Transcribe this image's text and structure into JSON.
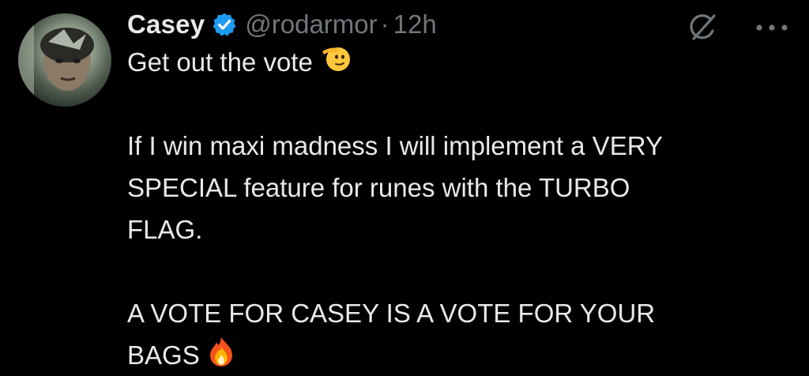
{
  "author": {
    "name": "Casey",
    "handle": "@rodarmor",
    "separator": "·",
    "time": "12h",
    "verified_icon": "verified-badge-icon",
    "avatar_icon": "avatar"
  },
  "tweet": {
    "line1": "Get out the vote",
    "line1_emoji": "saluting-face-emoji",
    "line2": "If I win maxi madness I will implement a VERY",
    "line3": "SPECIAL feature for runes with the TURBO",
    "line4": "FLAG.",
    "line5": "A VOTE FOR CASEY IS A VOTE FOR YOUR",
    "line6": "BAGS",
    "line6_emoji": "fire-emoji"
  },
  "actions": {
    "grok_icon": "grok-icon",
    "more_icon": "more-options-icon"
  },
  "colors": {
    "background": "#000000",
    "text_primary": "#e7e9ea",
    "text_secondary": "#71767b",
    "verified_blue": "#1d9bf0"
  }
}
